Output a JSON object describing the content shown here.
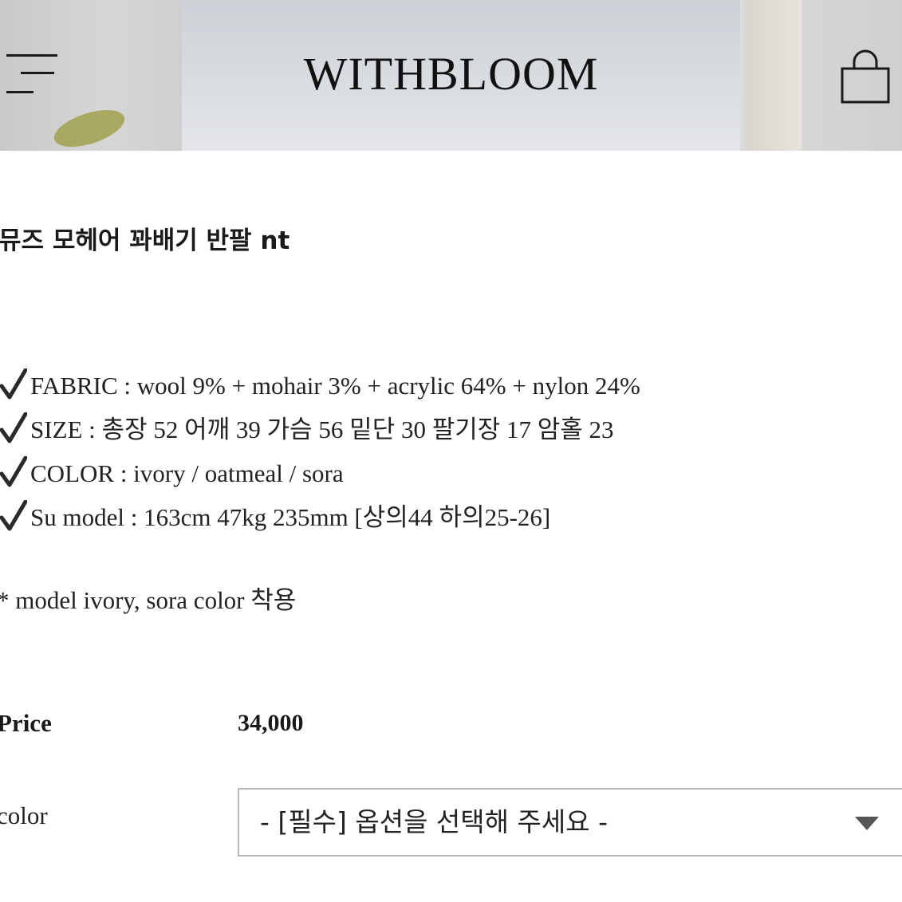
{
  "header": {
    "brand": "WITHBLOOM",
    "menu_icon": "hamburger-menu-icon",
    "cart_icon": "shopping-bag-icon"
  },
  "product": {
    "title": "뮤즈 모헤어 꽈배기 반팔 nt",
    "specs": [
      {
        "icon": "checkmark-icon",
        "text": "FABRIC : wool 9% + mohair 3% + acrylic 64% + nylon 24%"
      },
      {
        "icon": "checkmark-icon",
        "text": "SIZE : 총장 52 어깨 39 가슴 56 밑단 30 팔기장 17 암홀 23"
      },
      {
        "icon": "checkmark-icon",
        "text": "COLOR : ivory / oatmeal / sora"
      },
      {
        "icon": "checkmark-icon",
        "text": "Su model : 163cm 47kg 235mm [상의44 하의25-26]"
      }
    ],
    "note": "* model ivory, sora color 착용",
    "price_label": "Price",
    "price_value": "34,000",
    "color_label": "color",
    "color_select": {
      "selected": "- [필수] 옵션을 선택해 주세요 -",
      "icon": "dropdown-triangle-icon"
    }
  },
  "colors": {
    "text": "#1a1a1a",
    "select_border": "#b9b9b9",
    "dropdown_arrow": "#555555"
  }
}
